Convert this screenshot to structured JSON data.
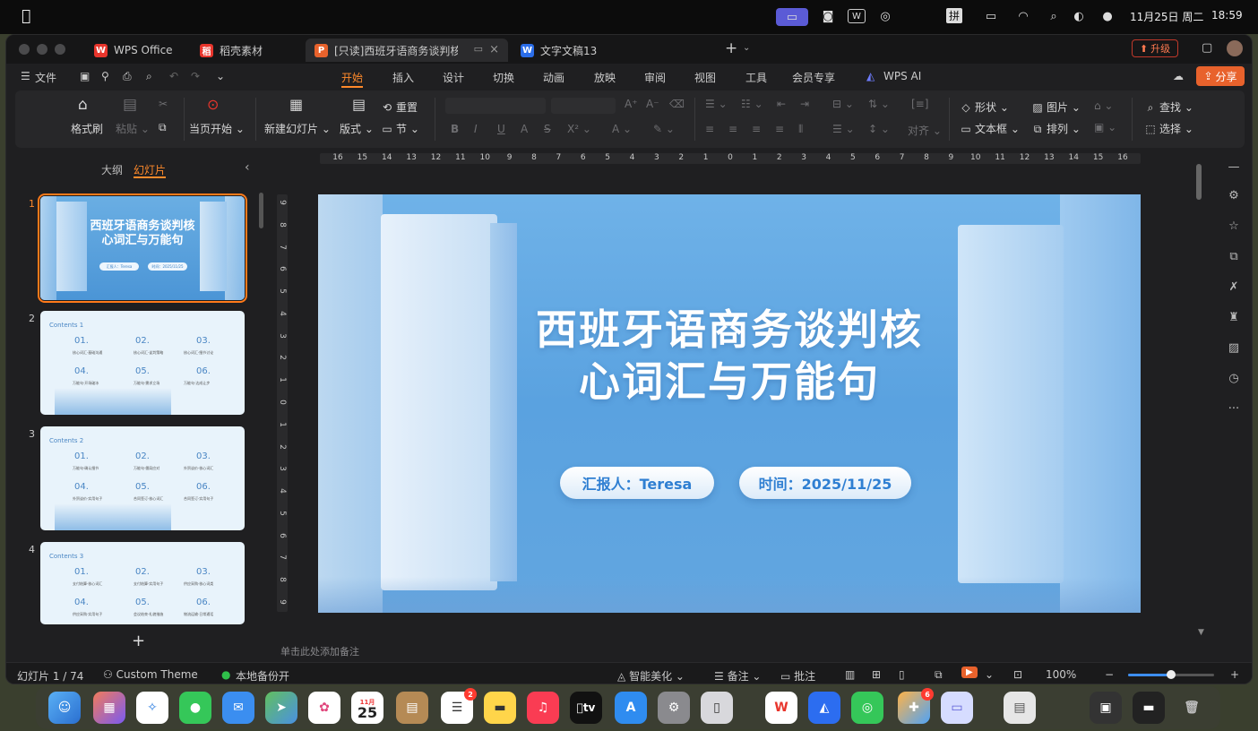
{
  "menubar": {
    "date": "11月25日 周二",
    "time": "18:59",
    "ime": "拼",
    "icons": [
      "screen-mirroring-icon",
      "meeting-icon",
      "wps-icon",
      "wechat-icon",
      "battery-icon",
      "wifi-icon",
      "search-icon",
      "control-center-icon",
      "siri-icon"
    ]
  },
  "tabs": [
    {
      "label": "WPS Office",
      "icon": "W",
      "color": "#e8352c"
    },
    {
      "label": "稻壳素材",
      "icon": "稻",
      "color": "#e8352c"
    },
    {
      "label": "[只读]西班牙语商务谈判核心",
      "icon": "P",
      "color": "#e8622c",
      "active": true
    },
    {
      "label": "文字文稿13",
      "icon": "W",
      "color": "#2b6de8"
    }
  ],
  "titlebar": {
    "upgrade": "升级",
    "new_tab": "+"
  },
  "menu": {
    "file": "文件",
    "items": [
      "开始",
      "插入",
      "设计",
      "切换",
      "动画",
      "放映",
      "审阅",
      "视图",
      "工具",
      "会员专享",
      "WPS AI"
    ],
    "active": "开始",
    "share": "分享"
  },
  "ribbon": {
    "format_painter": "格式刷",
    "paste": "粘贴",
    "play_from_start": "当页开始",
    "new_slide": "新建幻灯片",
    "layout": "版式",
    "reset": "重置",
    "section": "节",
    "shape": "形状",
    "picture": "图片",
    "find": "查找",
    "textbox": "文本框",
    "arrange": "排列",
    "select": "选择",
    "align": "对齐"
  },
  "leftpanel": {
    "tab_outline": "大纲",
    "tab_slides": "幻灯片",
    "add": "+",
    "thumbs": [
      {
        "num": "1",
        "title": "西班牙语商务谈判核心词汇与万能句",
        "line1": "西班牙语商务谈判核",
        "line2": "心词汇与万能句",
        "reporter": "汇报人：Teresa",
        "date": "时间：2025/11/25"
      },
      {
        "num": "2",
        "heading": "Contents 1",
        "items": [
          [
            "01.",
            "核心词汇·基础沟通"
          ],
          [
            "02.",
            "核心词汇·谈判策略"
          ],
          [
            "03.",
            "核心词汇·细节讨论"
          ],
          [
            "04.",
            "万能句·开场破冰"
          ],
          [
            "05.",
            "万能句·需求立场"
          ],
          [
            "06.",
            "万能句·达成让步"
          ]
        ]
      },
      {
        "num": "3",
        "heading": "Contents 2",
        "items": [
          [
            "01.",
            "万能句·确认细节"
          ],
          [
            "02.",
            "万能句·僵局应对"
          ],
          [
            "03.",
            "外贸谈价·核心词汇"
          ],
          [
            "04.",
            "外贸谈价·实用句子"
          ],
          [
            "05.",
            "合同签订·核心词汇"
          ],
          [
            "06.",
            "合同签订·实用句子"
          ]
        ]
      },
      {
        "num": "4",
        "heading": "Contents 3",
        "items": [
          [
            "01.",
            "支付结算·核心词汇"
          ],
          [
            "02.",
            "支付结算·实用句子"
          ],
          [
            "03.",
            "供应采购·核心词类"
          ],
          [
            "04.",
            "供应采购·实用句子"
          ],
          [
            "05.",
            "会议结束·礼貌措施"
          ],
          [
            "06.",
            "物流运输·日常通话"
          ]
        ]
      }
    ]
  },
  "ruler": {
    "h": [
      "16",
      "15",
      "14",
      "13",
      "12",
      "11",
      "10",
      "9",
      "8",
      "7",
      "6",
      "5",
      "4",
      "3",
      "2",
      "1",
      "0",
      "1",
      "2",
      "3",
      "4",
      "5",
      "6",
      "7",
      "8",
      "9",
      "10",
      "11",
      "12",
      "13",
      "14",
      "15",
      "16"
    ],
    "v": [
      "9",
      "8",
      "7",
      "6",
      "5",
      "4",
      "3",
      "2",
      "1",
      "0",
      "1",
      "2",
      "3",
      "4",
      "5",
      "6",
      "7",
      "8",
      "9"
    ]
  },
  "slide": {
    "title_line1": "西班牙语商务谈判核",
    "title_line2": "心词汇与万能句",
    "reporter": "汇报人：Teresa",
    "date": "时间：2025/11/25"
  },
  "notes_placeholder": "单击此处添加备注",
  "status": {
    "slide_counter": "幻灯片 1 / 74",
    "theme": "Custom Theme",
    "backup": "本地备份开",
    "beautify": "智能美化",
    "notes": "备注",
    "comments": "批注",
    "zoom": "100%",
    "zoom_minus": "−",
    "zoom_plus": "+",
    "zoom_fraction": 0.5
  },
  "dock": {
    "calendar_month": "11月",
    "calendar_day": "25",
    "reminders_badge": "2",
    "app_badge": "6",
    "tv_label": "tv"
  }
}
